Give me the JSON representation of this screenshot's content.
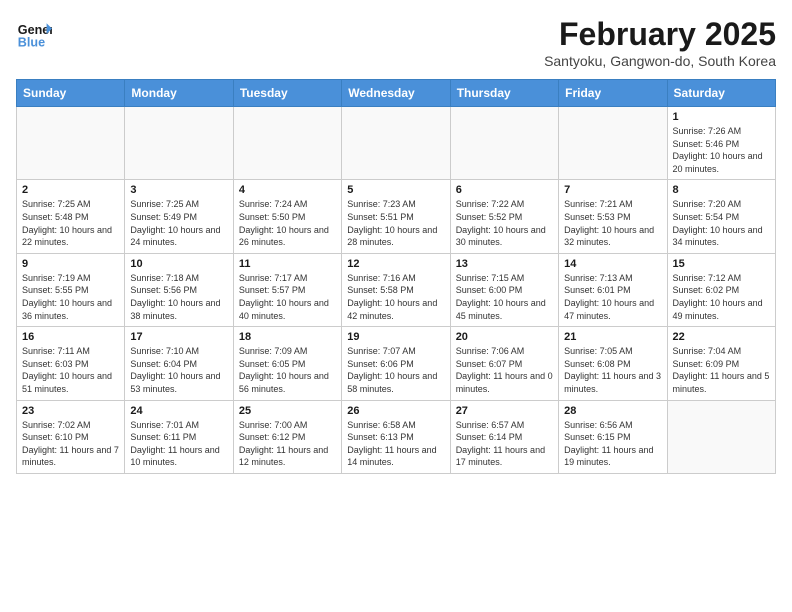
{
  "header": {
    "logo_line1": "General",
    "logo_line2": "Blue",
    "title": "February 2025",
    "subtitle": "Santyoku, Gangwon-do, South Korea"
  },
  "days_of_week": [
    "Sunday",
    "Monday",
    "Tuesday",
    "Wednesday",
    "Thursday",
    "Friday",
    "Saturday"
  ],
  "weeks": [
    [
      {
        "day": "",
        "info": ""
      },
      {
        "day": "",
        "info": ""
      },
      {
        "day": "",
        "info": ""
      },
      {
        "day": "",
        "info": ""
      },
      {
        "day": "",
        "info": ""
      },
      {
        "day": "",
        "info": ""
      },
      {
        "day": "1",
        "info": "Sunrise: 7:26 AM\nSunset: 5:46 PM\nDaylight: 10 hours and 20 minutes."
      }
    ],
    [
      {
        "day": "2",
        "info": "Sunrise: 7:25 AM\nSunset: 5:48 PM\nDaylight: 10 hours and 22 minutes."
      },
      {
        "day": "3",
        "info": "Sunrise: 7:25 AM\nSunset: 5:49 PM\nDaylight: 10 hours and 24 minutes."
      },
      {
        "day": "4",
        "info": "Sunrise: 7:24 AM\nSunset: 5:50 PM\nDaylight: 10 hours and 26 minutes."
      },
      {
        "day": "5",
        "info": "Sunrise: 7:23 AM\nSunset: 5:51 PM\nDaylight: 10 hours and 28 minutes."
      },
      {
        "day": "6",
        "info": "Sunrise: 7:22 AM\nSunset: 5:52 PM\nDaylight: 10 hours and 30 minutes."
      },
      {
        "day": "7",
        "info": "Sunrise: 7:21 AM\nSunset: 5:53 PM\nDaylight: 10 hours and 32 minutes."
      },
      {
        "day": "8",
        "info": "Sunrise: 7:20 AM\nSunset: 5:54 PM\nDaylight: 10 hours and 34 minutes."
      }
    ],
    [
      {
        "day": "9",
        "info": "Sunrise: 7:19 AM\nSunset: 5:55 PM\nDaylight: 10 hours and 36 minutes."
      },
      {
        "day": "10",
        "info": "Sunrise: 7:18 AM\nSunset: 5:56 PM\nDaylight: 10 hours and 38 minutes."
      },
      {
        "day": "11",
        "info": "Sunrise: 7:17 AM\nSunset: 5:57 PM\nDaylight: 10 hours and 40 minutes."
      },
      {
        "day": "12",
        "info": "Sunrise: 7:16 AM\nSunset: 5:58 PM\nDaylight: 10 hours and 42 minutes."
      },
      {
        "day": "13",
        "info": "Sunrise: 7:15 AM\nSunset: 6:00 PM\nDaylight: 10 hours and 45 minutes."
      },
      {
        "day": "14",
        "info": "Sunrise: 7:13 AM\nSunset: 6:01 PM\nDaylight: 10 hours and 47 minutes."
      },
      {
        "day": "15",
        "info": "Sunrise: 7:12 AM\nSunset: 6:02 PM\nDaylight: 10 hours and 49 minutes."
      }
    ],
    [
      {
        "day": "16",
        "info": "Sunrise: 7:11 AM\nSunset: 6:03 PM\nDaylight: 10 hours and 51 minutes."
      },
      {
        "day": "17",
        "info": "Sunrise: 7:10 AM\nSunset: 6:04 PM\nDaylight: 10 hours and 53 minutes."
      },
      {
        "day": "18",
        "info": "Sunrise: 7:09 AM\nSunset: 6:05 PM\nDaylight: 10 hours and 56 minutes."
      },
      {
        "day": "19",
        "info": "Sunrise: 7:07 AM\nSunset: 6:06 PM\nDaylight: 10 hours and 58 minutes."
      },
      {
        "day": "20",
        "info": "Sunrise: 7:06 AM\nSunset: 6:07 PM\nDaylight: 11 hours and 0 minutes."
      },
      {
        "day": "21",
        "info": "Sunrise: 7:05 AM\nSunset: 6:08 PM\nDaylight: 11 hours and 3 minutes."
      },
      {
        "day": "22",
        "info": "Sunrise: 7:04 AM\nSunset: 6:09 PM\nDaylight: 11 hours and 5 minutes."
      }
    ],
    [
      {
        "day": "23",
        "info": "Sunrise: 7:02 AM\nSunset: 6:10 PM\nDaylight: 11 hours and 7 minutes."
      },
      {
        "day": "24",
        "info": "Sunrise: 7:01 AM\nSunset: 6:11 PM\nDaylight: 11 hours and 10 minutes."
      },
      {
        "day": "25",
        "info": "Sunrise: 7:00 AM\nSunset: 6:12 PM\nDaylight: 11 hours and 12 minutes."
      },
      {
        "day": "26",
        "info": "Sunrise: 6:58 AM\nSunset: 6:13 PM\nDaylight: 11 hours and 14 minutes."
      },
      {
        "day": "27",
        "info": "Sunrise: 6:57 AM\nSunset: 6:14 PM\nDaylight: 11 hours and 17 minutes."
      },
      {
        "day": "28",
        "info": "Sunrise: 6:56 AM\nSunset: 6:15 PM\nDaylight: 11 hours and 19 minutes."
      },
      {
        "day": "",
        "info": ""
      }
    ]
  ]
}
